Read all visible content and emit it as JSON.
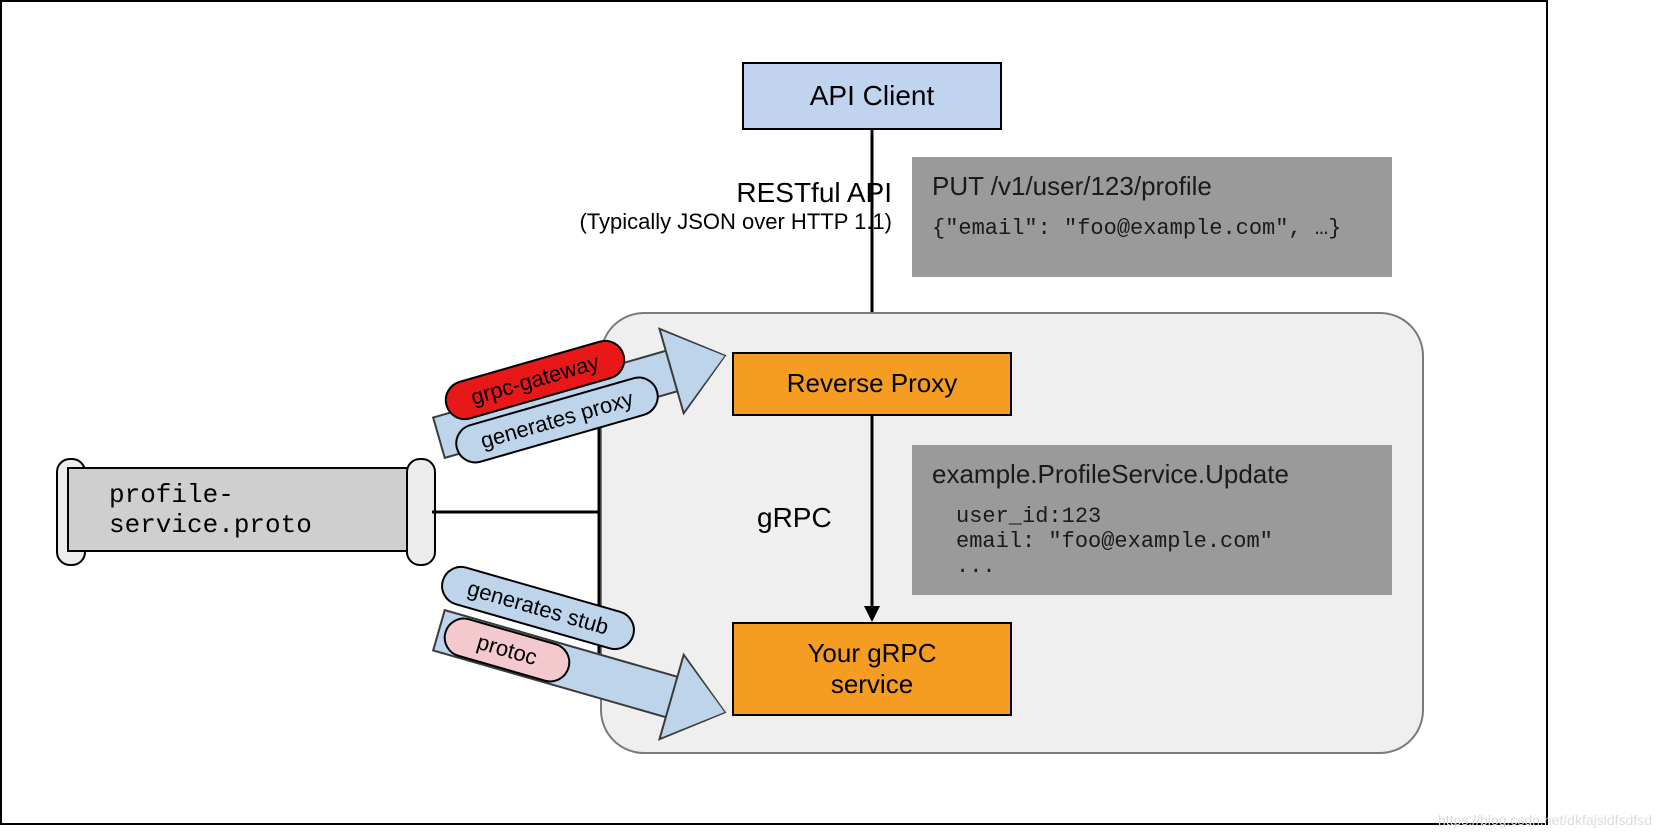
{
  "nodes": {
    "api_client": "API Client",
    "reverse_proxy": "Reverse Proxy",
    "grpc_service": "Your gRPC\nservice",
    "proto_file": "profile-service.proto"
  },
  "labels": {
    "rest_title": "RESTful API",
    "rest_subtitle": "(Typically JSON over HTTP 1.1)",
    "grpc": "gRPC",
    "grpc_gateway": "grpc-gateway",
    "generates_proxy": "generates proxy",
    "generates_stub": "generates stub",
    "protoc": "protoc"
  },
  "rest_snippet": {
    "request": "PUT /v1/user/123/profile",
    "body": "{\"email\": \"foo@example.com\", …}"
  },
  "grpc_snippet": {
    "method": "example.ProfileService.Update",
    "body": "user_id:123\nemail: \"foo@example.com\"\n..."
  },
  "watermark": "https://blog.csdn.net/dkfajsldfsdfsd"
}
